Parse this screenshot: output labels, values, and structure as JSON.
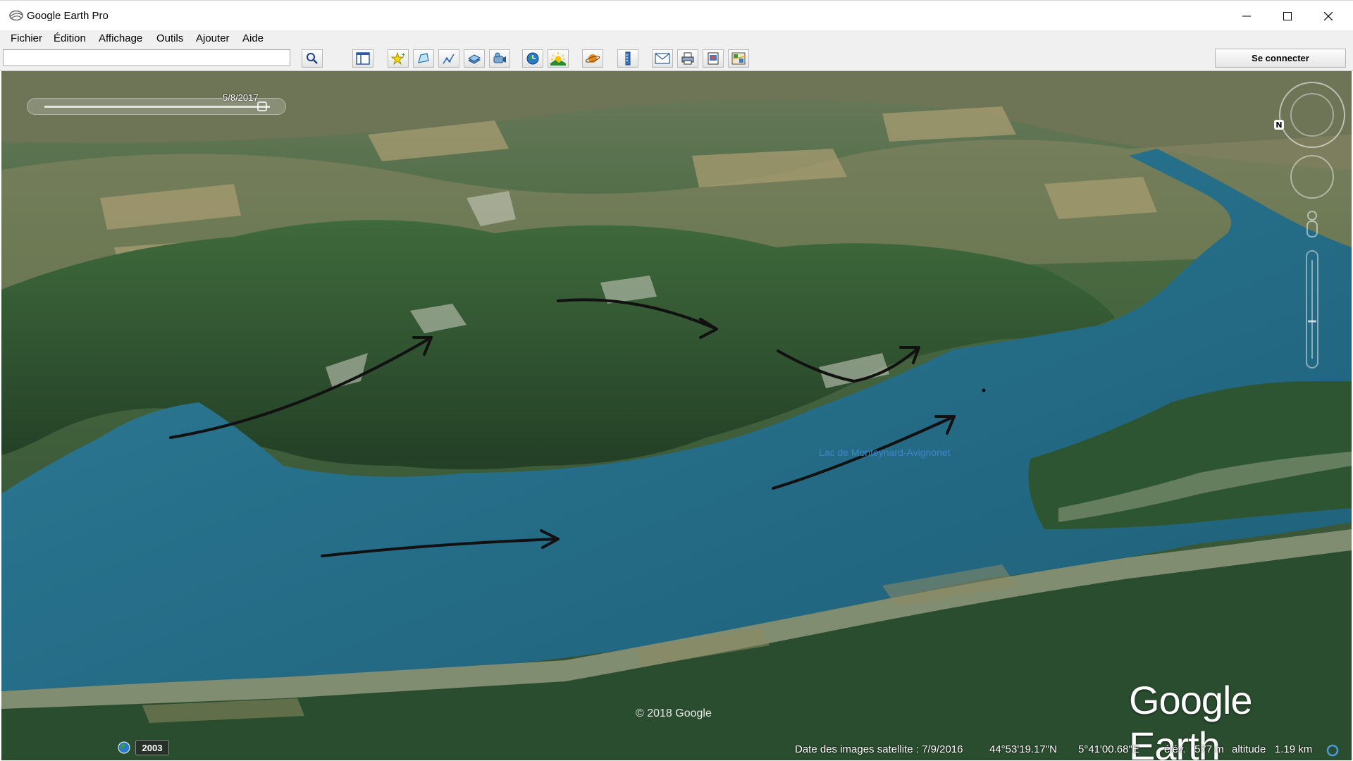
{
  "window": {
    "title": "Google Earth Pro"
  },
  "menu": {
    "items": [
      "Fichier",
      "Édition",
      "Affichage",
      "Outils",
      "Ajouter",
      "Aide"
    ]
  },
  "toolbar": {
    "search_value": "",
    "signin_label": "Se connecter",
    "buttons": [
      "sidebar-icon",
      "placemark-icon",
      "polygon-icon",
      "path-icon",
      "image-overlay-icon",
      "record-tour-icon",
      "historical-imagery-icon",
      "sunlight-icon",
      "planets-icon",
      "ruler-icon",
      "email-icon",
      "print-icon",
      "save-image-icon",
      "view-in-maps-icon"
    ]
  },
  "map": {
    "time_slider_date": "5/8/2017",
    "lake_label": "Lac de Monteynard-Avignonet",
    "copyright": "© 2018 Google",
    "logo": "Google Earth",
    "imagery_year": "2003",
    "compass_north": "N",
    "status": {
      "imagery_date": "Date des images satellite : 7/9/2016",
      "latitude": "44°53'19.17\"N",
      "longitude": "5°41'00.68\"E",
      "elevation": "élév.   577 m",
      "altitude": "altitude   1.19 km"
    }
  },
  "colors": {
    "lake": "#2a7391",
    "forest": "#34573a",
    "annotation_arrows": "#111111"
  }
}
